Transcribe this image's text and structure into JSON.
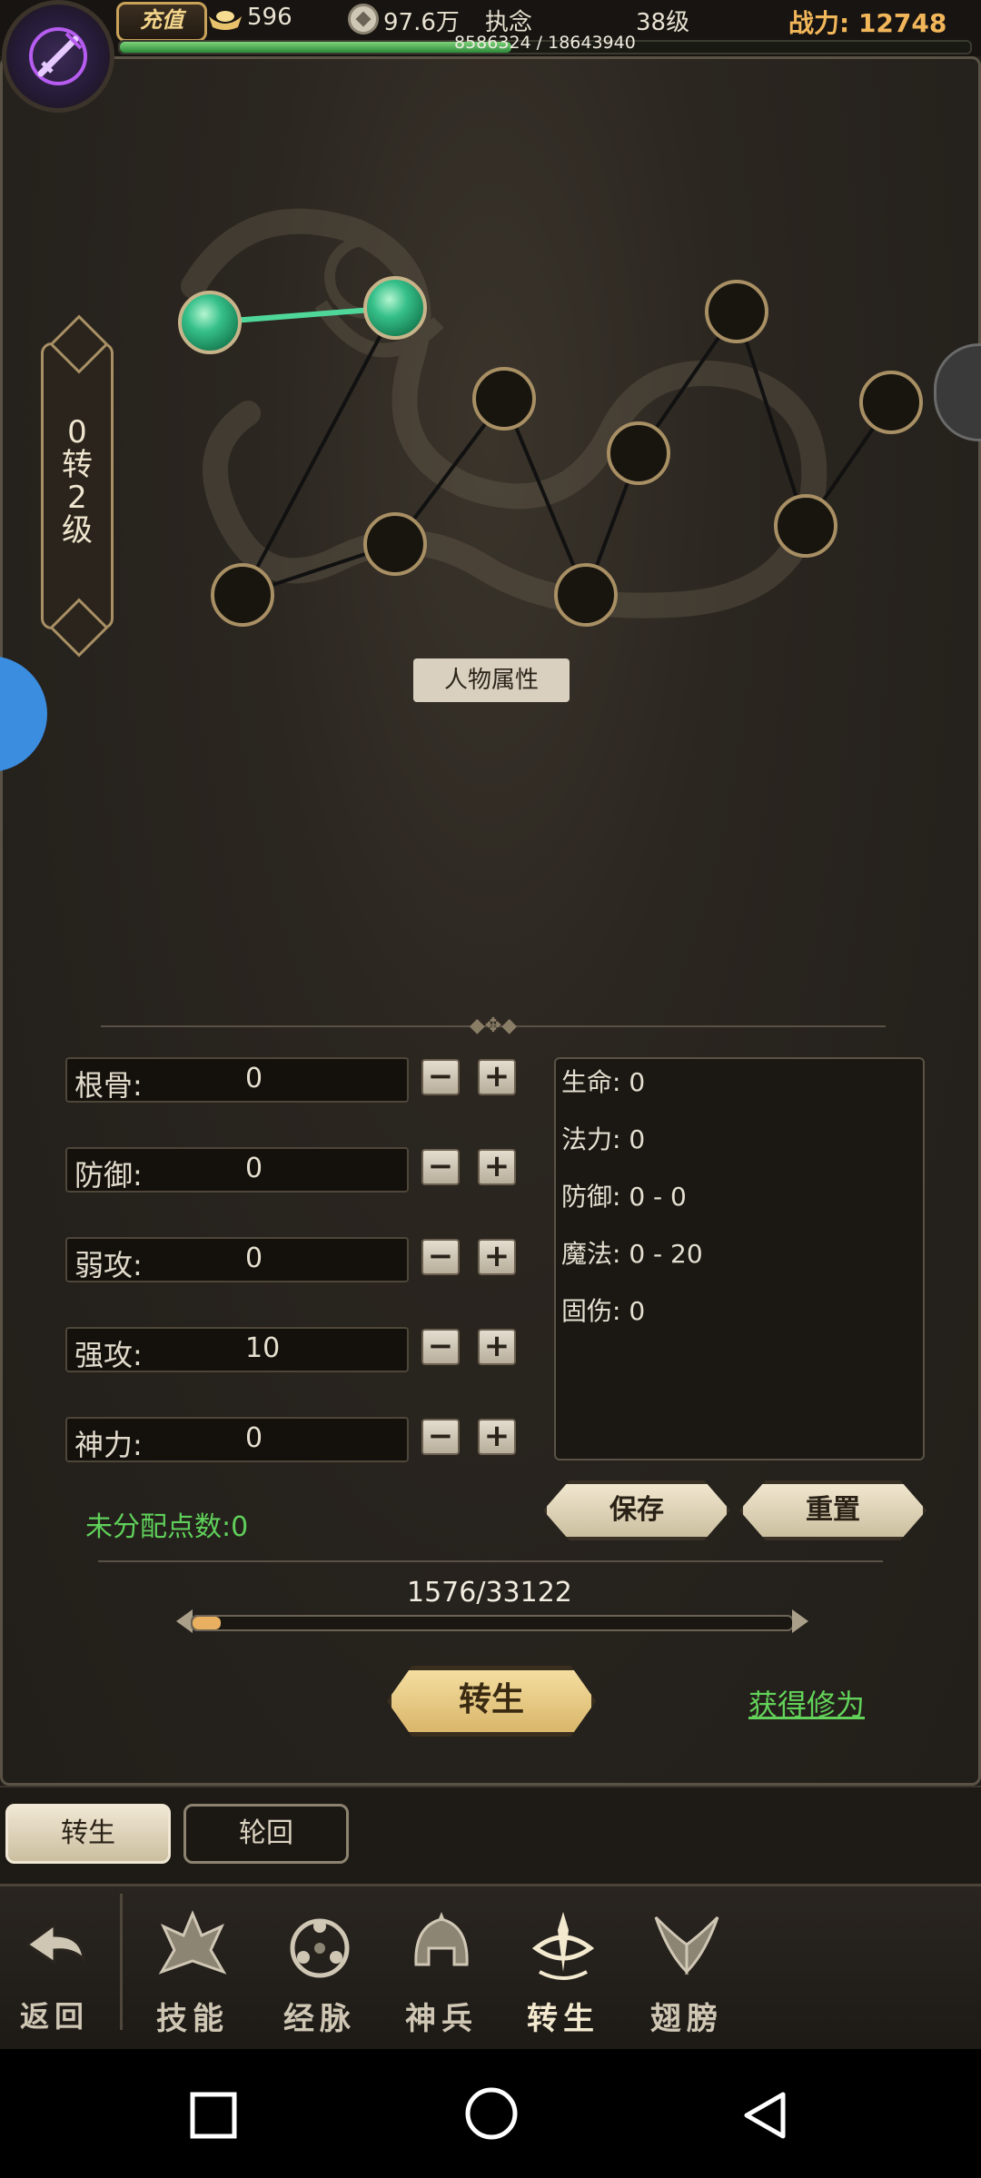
{
  "hud": {
    "recharge_label": "充值",
    "gold": "596",
    "coins": "97.6万",
    "player_name": "执念",
    "level": "38级",
    "power_label": "战力:",
    "power_value": "12748",
    "exp_text": "8586324 / 18643940",
    "exp_progress": 0.46
  },
  "rank": {
    "text": "0转2级"
  },
  "tree": {
    "title": "人物属性"
  },
  "attributes": [
    {
      "label": "根骨:",
      "value": "0"
    },
    {
      "label": "防御:",
      "value": "0"
    },
    {
      "label": "弱攻:",
      "value": "0"
    },
    {
      "label": "强攻:",
      "value": "10"
    },
    {
      "label": "神力:",
      "value": "0"
    }
  ],
  "stats": [
    "生命: 0",
    "法力: 0",
    "防御: 0 - 0",
    "魔法: 0 - 20",
    "固伤: 0"
  ],
  "unallocated": "未分配点数:0",
  "save_label": "保存",
  "reset_label": "重置",
  "progress": {
    "text": "1576/33122",
    "current": 1576,
    "total": 33122
  },
  "rebirth_label": "转生",
  "gain_label": "获得修为",
  "subtabs": [
    "转生",
    "轮回"
  ],
  "nav": {
    "back": "返回",
    "items": [
      "技能",
      "经脉",
      "神兵",
      "转生",
      "翅膀"
    ]
  },
  "colors": {
    "accent_green": "#5fd05a",
    "gold": "#c9a25a",
    "node_active": "#36c08a"
  }
}
